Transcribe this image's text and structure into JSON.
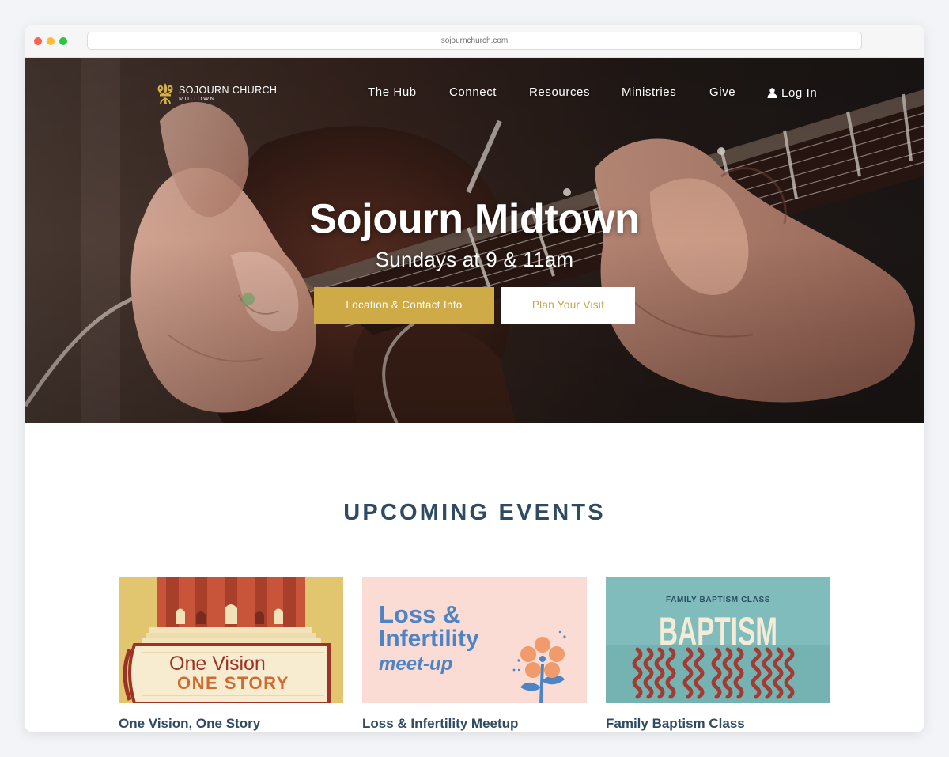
{
  "browser": {
    "url": "sojournchurch.com"
  },
  "header": {
    "logo_name": "SOJOURN CHURCH",
    "logo_sub": "MIDTOWN",
    "nav": [
      {
        "label": "The Hub"
      },
      {
        "label": "Connect"
      },
      {
        "label": "Resources"
      },
      {
        "label": "Ministries"
      },
      {
        "label": "Give"
      }
    ],
    "login_label": "Log In",
    "icons": {
      "logo": "fleur-de-lis-icon",
      "login": "user-icon"
    }
  },
  "hero": {
    "title": "Sojourn Midtown",
    "subtitle": "Sundays at 9 & 11am",
    "buttons": {
      "location": "Location & Contact Info",
      "visit": "Plan Your Visit"
    }
  },
  "events": {
    "heading": "UPCOMING EVENTS",
    "cards": [
      {
        "title": "One Vision, One Story",
        "art_line1": "One Vision",
        "art_line2": "ONE STORY"
      },
      {
        "title": "Loss & Infertility Meetup",
        "art_line1": "Loss &",
        "art_line2": "Infertility",
        "art_line3": "meet-up"
      },
      {
        "title": "Family Baptism Class",
        "art_line1": "FAMILY BAPTISM CLASS",
        "art_line2": "BAPTISM"
      }
    ]
  },
  "colors": {
    "gold": "#cfab47",
    "navy": "#2f4a63",
    "white": "#ffffff"
  }
}
